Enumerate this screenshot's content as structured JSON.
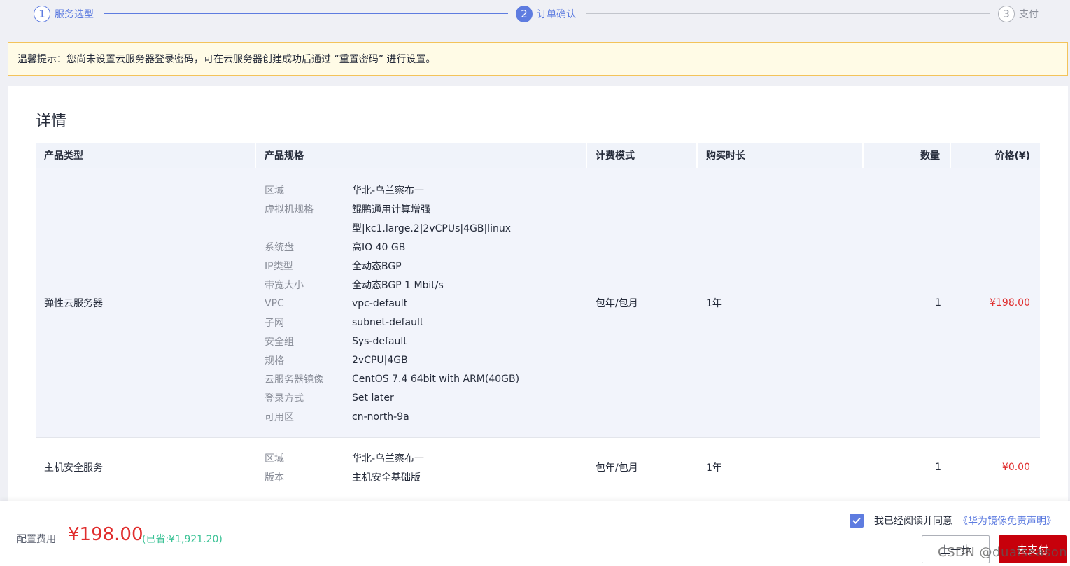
{
  "steps": [
    {
      "num": "1",
      "label": "服务选型",
      "state": "done"
    },
    {
      "num": "2",
      "label": "订单确认",
      "state": "active"
    },
    {
      "num": "3",
      "label": "支付",
      "state": "todo"
    }
  ],
  "notice": "温馨提示：您尚未设置云服务器登录密码，可在云服务器创建成功后通过 “重置密码” 进行设置。",
  "details": {
    "title": "详情",
    "columns": [
      "产品类型",
      "产品规格",
      "计费模式",
      "购买时长",
      "数量",
      "价格(¥)"
    ],
    "rows": [
      {
        "product": "弹性云服务器",
        "specs": [
          {
            "key": "区域",
            "value": "华北-乌兰察布一"
          },
          {
            "key": "虚拟机规格",
            "value": "鲲鹏通用计算增强"
          },
          {
            "key": "",
            "value": "型|kc1.large.2|2vCPUs|4GB|linux"
          },
          {
            "key": "系统盘",
            "value": "高IO 40 GB"
          },
          {
            "key": "IP类型",
            "value": "全动态BGP"
          },
          {
            "key": "带宽大小",
            "value": "全动态BGP 1 Mbit/s"
          },
          {
            "key": "VPC",
            "value": "vpc-default"
          },
          {
            "key": "子网",
            "value": "subnet-default"
          },
          {
            "key": "安全组",
            "value": "Sys-default"
          },
          {
            "key": "规格",
            "value": "2vCPU|4GB"
          },
          {
            "key": "云服务器镜像",
            "value": "CentOS 7.4 64bit with ARM(40GB)"
          },
          {
            "key": "登录方式",
            "value": "Set later"
          },
          {
            "key": "可用区",
            "value": "cn-north-9a"
          }
        ],
        "billing": "包年/包月",
        "duration": "1年",
        "quantity": "1",
        "price": "¥198.00"
      },
      {
        "product": "主机安全服务",
        "specs": [
          {
            "key": "区域",
            "value": "华北-乌兰察布一"
          },
          {
            "key": "版本",
            "value": "主机安全基础版"
          }
        ],
        "billing": "包年/包月",
        "duration": "1年",
        "quantity": "1",
        "price": "¥0.00"
      }
    ]
  },
  "footer": {
    "fee_label": "配置费用",
    "fee_amount": "¥198.00",
    "saved": "(已省:¥1,921.20)",
    "agree_text": "我已经阅读并同意",
    "agree_link": "《华为镜像免责声明》",
    "prev_button": "上一步",
    "pay_button": "去支付"
  },
  "watermark": "CSDN @dualseason",
  "colors": {
    "accent": "#5e7ce0",
    "price": "#e02d2d",
    "pay_button": "#c7000b",
    "saved": "#3ac295"
  }
}
